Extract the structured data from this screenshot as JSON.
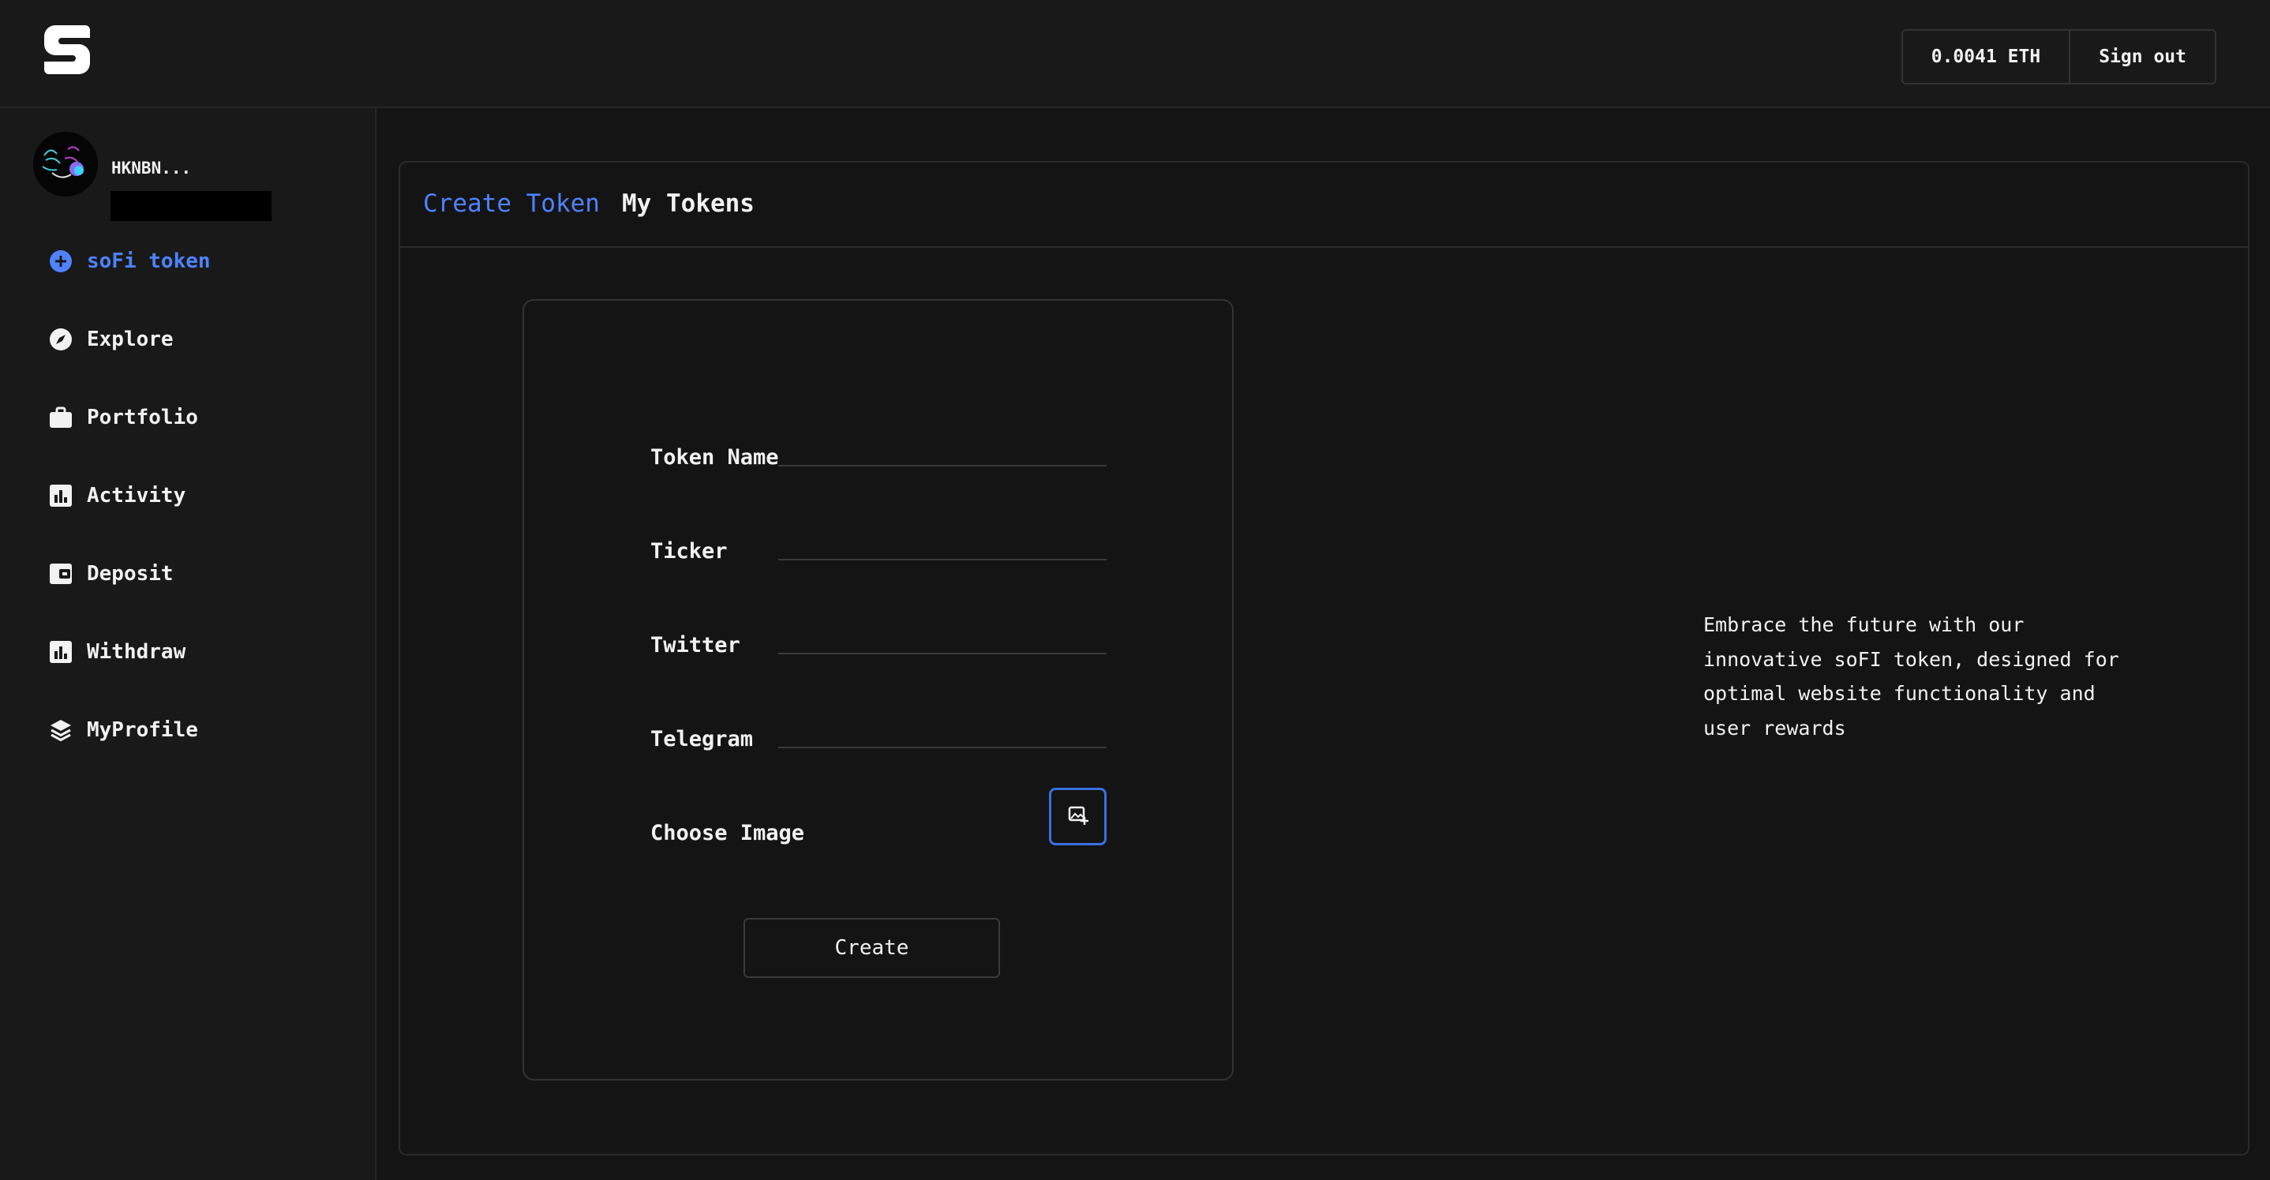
{
  "header": {
    "logo_icon": "sofi-logo-icon",
    "balance": "0.0041 ETH",
    "sign_out": "Sign out"
  },
  "profile": {
    "username": "HKNBN..."
  },
  "sidebar": {
    "items": [
      {
        "label": "soFi token",
        "icon": "plus-circle-icon",
        "active": true
      },
      {
        "label": "Explore",
        "icon": "compass-icon",
        "active": false
      },
      {
        "label": "Portfolio",
        "icon": "briefcase-icon",
        "active": false
      },
      {
        "label": "Activity",
        "icon": "bar-chart-icon",
        "active": false
      },
      {
        "label": "Deposit",
        "icon": "wallet-icon",
        "active": false
      },
      {
        "label": "Withdraw",
        "icon": "bar-chart-icon",
        "active": false
      },
      {
        "label": "MyProfile",
        "icon": "layers-icon",
        "active": false
      }
    ]
  },
  "tabs": [
    {
      "label": "Create Token",
      "active": true
    },
    {
      "label": "My Tokens",
      "active": false
    }
  ],
  "form": {
    "token_name_label": "Token Name",
    "token_name_value": "",
    "ticker_label": "Ticker",
    "ticker_value": "",
    "twitter_label": "Twitter",
    "twitter_value": "",
    "telegram_label": "Telegram",
    "telegram_value": "",
    "image_label": "Choose Image",
    "create_label": "Create"
  },
  "blurb": "Embrace the future with our innovative soFI token, designed for optimal website functionality and user rewards",
  "colors": {
    "accent": "#4f83ff",
    "background": "#141414",
    "sidebar": "#191919",
    "border": "#2a2a2a"
  }
}
